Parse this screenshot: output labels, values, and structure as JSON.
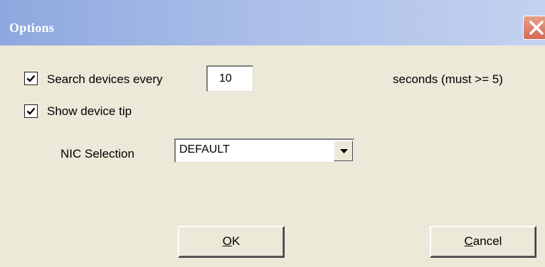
{
  "window": {
    "title": "Options",
    "close_icon": "close-x-icon"
  },
  "search": {
    "checked": true,
    "label": "Search devices every",
    "interval_value": "10",
    "hint": "seconds (must >= 5)"
  },
  "tip": {
    "checked": true,
    "label": "Show device tip"
  },
  "nic": {
    "label": "NIC Selection",
    "selected": "DEFAULT"
  },
  "buttons": {
    "ok_accel": "O",
    "ok_rest": "K",
    "cancel_accel": "C",
    "cancel_rest": "ancel"
  },
  "colors": {
    "dialog_bg": "#ece9d8",
    "titlebar_start": "#8ea8df",
    "titlebar_end": "#c4d2f0",
    "close_button": "#d36b54"
  }
}
